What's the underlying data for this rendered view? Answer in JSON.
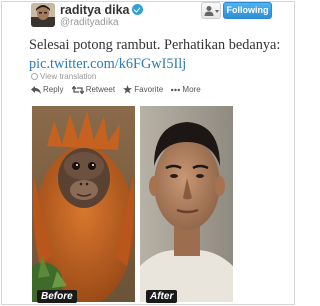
{
  "tweet": {
    "display_name": "raditya dika",
    "handle": "@radityadika",
    "follow_label": "Following",
    "text": "Selesai potong rambut. Perhatikan bedanya:",
    "link": "pic.twitter.com/k6FGwI5Ilj",
    "view_translation": "View translation"
  },
  "actions": [
    {
      "label": "Reply",
      "icon": "reply-icon"
    },
    {
      "label": "Retweet",
      "icon": "retweet-icon"
    },
    {
      "label": "Favorite",
      "icon": "star-icon"
    },
    {
      "label": "More",
      "icon": "more-icon"
    }
  ],
  "media": {
    "before_label": "Before",
    "after_label": "After"
  },
  "colors": {
    "link": "#2b7bb9",
    "follow_button": "#2f8fd6",
    "verified": "#2fa1db",
    "favorite": "#f5a623"
  }
}
